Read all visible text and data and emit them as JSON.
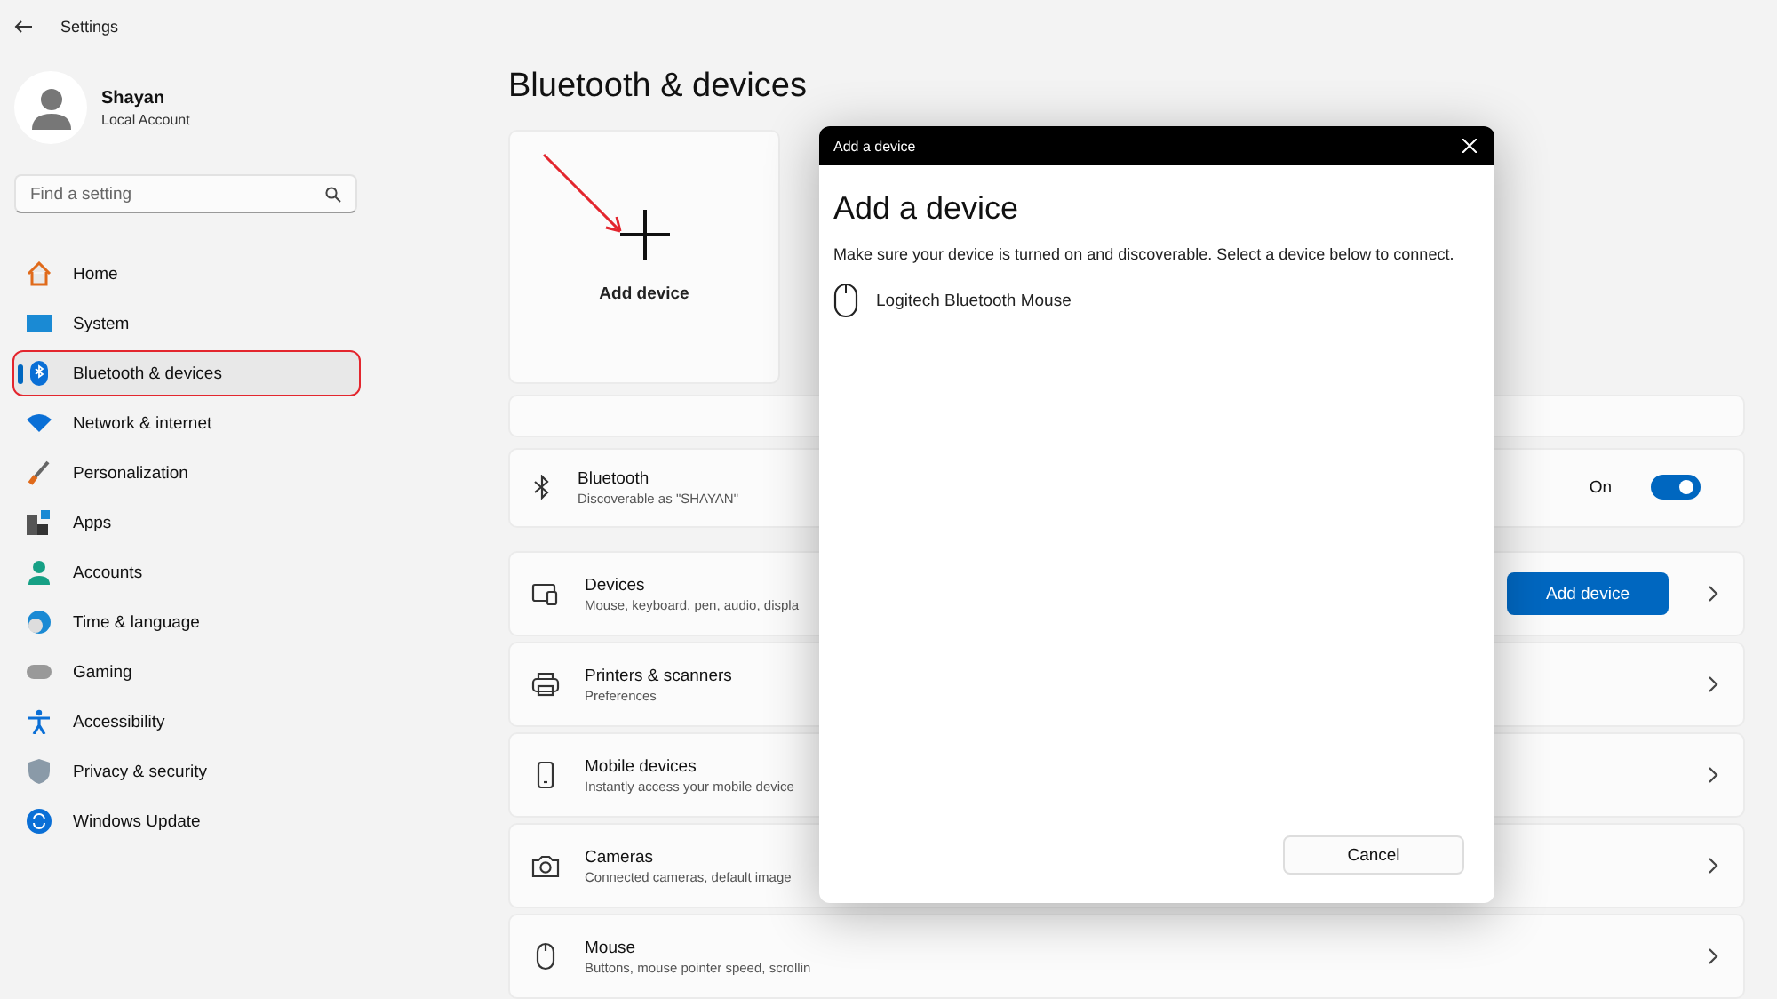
{
  "window": {
    "title": "Settings"
  },
  "account": {
    "name": "Shayan",
    "type": "Local Account"
  },
  "search": {
    "placeholder": "Find a setting"
  },
  "nav": [
    {
      "label": "Home",
      "selected": false,
      "highlighted": false
    },
    {
      "label": "System",
      "selected": false,
      "highlighted": false
    },
    {
      "label": "Bluetooth & devices",
      "selected": true,
      "highlighted": true
    },
    {
      "label": "Network & internet",
      "selected": false,
      "highlighted": false
    },
    {
      "label": "Personalization",
      "selected": false,
      "highlighted": false
    },
    {
      "label": "Apps",
      "selected": false,
      "highlighted": false
    },
    {
      "label": "Accounts",
      "selected": false,
      "highlighted": false
    },
    {
      "label": "Time & language",
      "selected": false,
      "highlighted": false
    },
    {
      "label": "Gaming",
      "selected": false,
      "highlighted": false
    },
    {
      "label": "Accessibility",
      "selected": false,
      "highlighted": false
    },
    {
      "label": "Privacy & security",
      "selected": false,
      "highlighted": false
    },
    {
      "label": "Windows Update",
      "selected": false,
      "highlighted": false
    }
  ],
  "page_title": "Bluetooth & devices",
  "add_card": {
    "label": "Add device"
  },
  "bluetooth": {
    "title": "Bluetooth",
    "subtitle": "Discoverable as \"SHAYAN\"",
    "state_label": "On",
    "on": true
  },
  "rows": [
    {
      "title": "Devices",
      "subtitle": "Mouse, keyboard, pen, audio, displa",
      "button": "Add device"
    },
    {
      "title": "Printers & scanners",
      "subtitle": "Preferences"
    },
    {
      "title": "Mobile devices",
      "subtitle": "Instantly access your mobile device"
    },
    {
      "title": "Cameras",
      "subtitle": "Connected cameras, default image"
    },
    {
      "title": "Mouse",
      "subtitle": "Buttons, mouse pointer speed, scrollin"
    }
  ],
  "dialog": {
    "title_bar": "Add a device",
    "heading": "Add a device",
    "text": "Make sure your device is turned on and discoverable. Select a device below to connect.",
    "devices": [
      {
        "name": "Logitech Bluetooth Mouse"
      }
    ],
    "cancel": "Cancel"
  }
}
